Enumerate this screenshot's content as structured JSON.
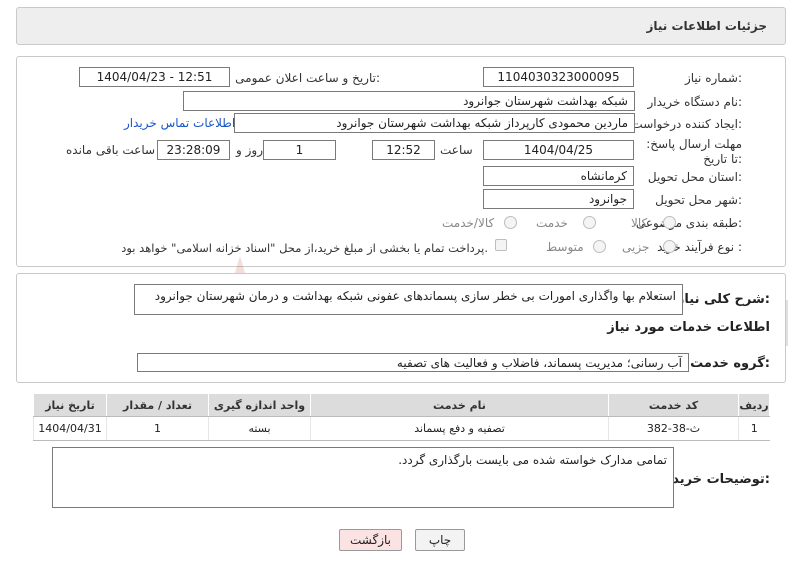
{
  "header": {
    "title": "جزئیات اطلاعات نیاز"
  },
  "fields": {
    "need_number_label": "شماره نیاز:",
    "need_number": "1104030323000095",
    "announce_label": "تاریخ و ساعت اعلان عمومی:",
    "announce_value": "1404/04/23 - 12:51",
    "buyer_org_label": "نام دستگاه خریدار:",
    "buyer_org": "شبکه بهداشت شهرستان جوانرود",
    "creator_label": "ایجاد کننده درخواست:",
    "creator": "ماردین محمودی کارپرداز شبکه بهداشت شهرستان جوانرود",
    "contact_link": "اطلاعات تماس خریدار",
    "deadline_label": "مهلت ارسال پاسخ: تا تاریخ:",
    "deadline_date": "1404/04/25",
    "time_label": "ساعت",
    "deadline_time": "12:52",
    "days_value": "1",
    "days_label": "روز و",
    "remaining_time": "23:28:09",
    "remaining_label": "ساعت باقی مانده",
    "province_label": "استان محل تحویل:",
    "province": "کرمانشاه",
    "city_label": "شهر محل تحویل:",
    "city": "جوانرود",
    "category_label": "طبقه بندی موضوعی:",
    "category_options": [
      "کالا",
      "خدمت",
      "کالا/خدمت"
    ],
    "process_label": "نوع فرآیند خرید :",
    "process_options": [
      "جزیی",
      "متوسط"
    ],
    "payment_note": "پرداخت تمام یا بخشی از مبلغ خرید،از محل \"اسناد خزانه اسلامی\" خواهد بود."
  },
  "summary": {
    "label": "شرح کلی نیاز:",
    "text": "استعلام بها واگذاری امورات بی خطر سازی پسماندهای عفونی شبکه بهداشت و درمان شهرستان جوانرود"
  },
  "services": {
    "section_title": "اطلاعات خدمات مورد نیاز",
    "group_label": "گروه خدمت:",
    "group_value": "آب رسانی؛ مدیریت پسماند، فاضلاب و فعالیت های تصفیه",
    "columns": [
      "ردیف",
      "کد خدمت",
      "نام خدمت",
      "واحد اندازه گیری",
      "تعداد / مقدار",
      "تاریخ نیاز"
    ],
    "rows": [
      {
        "row": "1",
        "code": "ث-38-382",
        "name": "تصفیه و دفع پسماند",
        "unit": "بسته",
        "qty": "1",
        "date": "1404/04/31"
      }
    ]
  },
  "buyer_notes": {
    "label": "توضیحات خریدار:",
    "text": "تمامی مدارک خواسته شده می بایست بارگذاری گردد."
  },
  "buttons": {
    "print": "چاپ",
    "back": "بازگشت"
  },
  "watermark": {
    "text": "AriaTender.net"
  },
  "colors": {
    "link": "#1a56c8",
    "header_bg": "#eeeeee",
    "back_btn_bg": "#fbe3e3"
  }
}
